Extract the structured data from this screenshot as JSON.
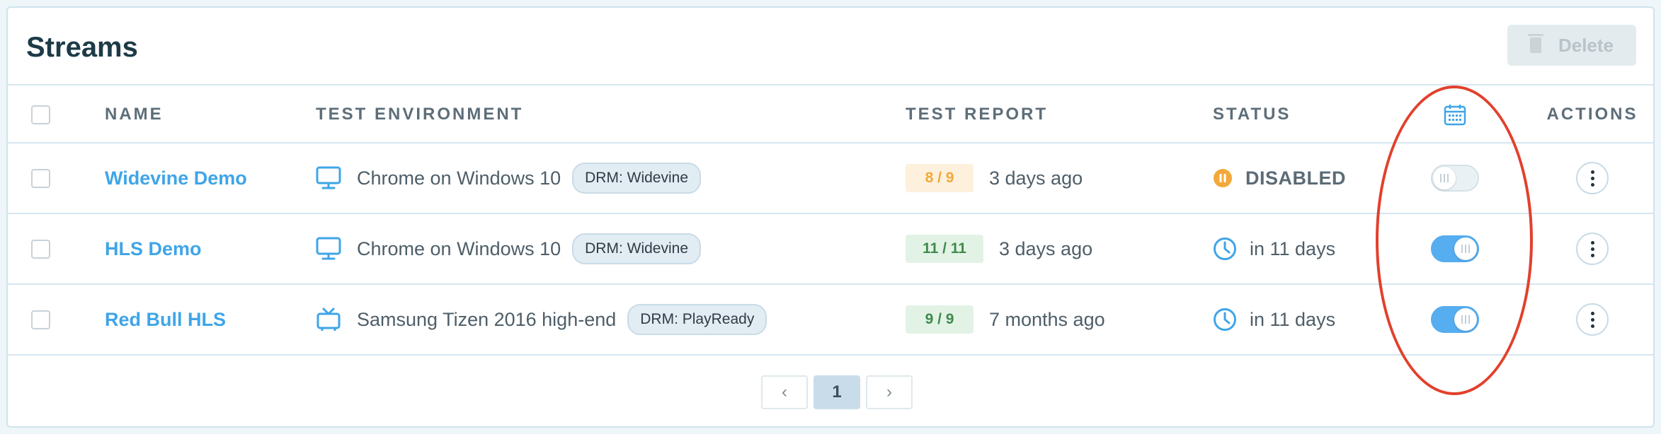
{
  "header": {
    "title": "Streams",
    "delete_label": "Delete"
  },
  "columns": {
    "name": "NAME",
    "environment": "TEST ENVIRONMENT",
    "report": "TEST REPORT",
    "status": "STATUS",
    "schedule_icon": "calendar-icon",
    "actions": "ACTIONS"
  },
  "rows": [
    {
      "name": "Widevine Demo",
      "env_icon": "monitor-icon",
      "environment": "Chrome on Windows 10",
      "drm": "DRM: Widevine",
      "report_score": "8 / 9",
      "report_state": "warning",
      "report_time": "3 days ago",
      "status_icon": "pause-icon",
      "status": "DISABLED",
      "schedule_enabled": false
    },
    {
      "name": "HLS Demo",
      "env_icon": "monitor-icon",
      "environment": "Chrome on Windows 10",
      "drm": "DRM: Widevine",
      "report_score": "11 / 11",
      "report_state": "success",
      "report_time": "3 days ago",
      "status_icon": "clock-icon",
      "status": "in 11 days",
      "schedule_enabled": true
    },
    {
      "name": "Red Bull HLS",
      "env_icon": "tv-icon",
      "environment": "Samsung Tizen 2016 high-end",
      "drm": "DRM: PlayReady",
      "report_score": "9 / 9",
      "report_state": "success",
      "report_time": "7 months ago",
      "status_icon": "clock-icon",
      "status": "in 11 days",
      "schedule_enabled": true
    }
  ],
  "pagination": {
    "prev": "‹",
    "current": "1",
    "next": "›"
  },
  "colors": {
    "link": "#3fa5e8",
    "toggle_on": "#56adf0",
    "warning": "#f2a93b",
    "success": "#3f8a4c",
    "annotation": "#e2402c"
  }
}
